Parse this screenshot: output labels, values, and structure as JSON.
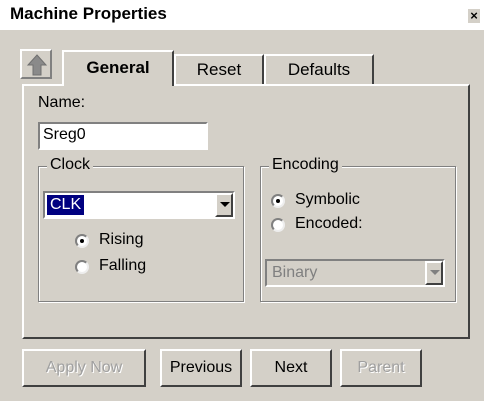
{
  "window": {
    "title": "Machine Properties",
    "close_glyph": "×"
  },
  "toolbar": {
    "up_icon": "up-arrow-icon"
  },
  "tabs": [
    {
      "label": "General",
      "active": true
    },
    {
      "label": "Reset",
      "active": false
    },
    {
      "label": "Defaults",
      "active": false
    }
  ],
  "general": {
    "name_label": "Name:",
    "name_value": "Sreg0",
    "clock": {
      "title": "Clock",
      "signal": "CLK",
      "edges": [
        {
          "label": "Rising",
          "selected": true
        },
        {
          "label": "Falling",
          "selected": false
        }
      ]
    },
    "encoding": {
      "title": "Encoding",
      "options": [
        {
          "label": "Symbolic",
          "selected": true
        },
        {
          "label": "Encoded:",
          "selected": false
        }
      ],
      "encoded_type": "Binary",
      "encoded_type_enabled": false
    }
  },
  "buttons": [
    {
      "label": "Apply Now",
      "enabled": false
    },
    {
      "label": "Previous",
      "enabled": true
    },
    {
      "label": "Next",
      "enabled": true
    },
    {
      "label": "Parent",
      "enabled": false
    }
  ],
  "colors": {
    "face": "#d4d0c8",
    "selection": "#000080",
    "disabled_text": "#a0a0a0"
  }
}
